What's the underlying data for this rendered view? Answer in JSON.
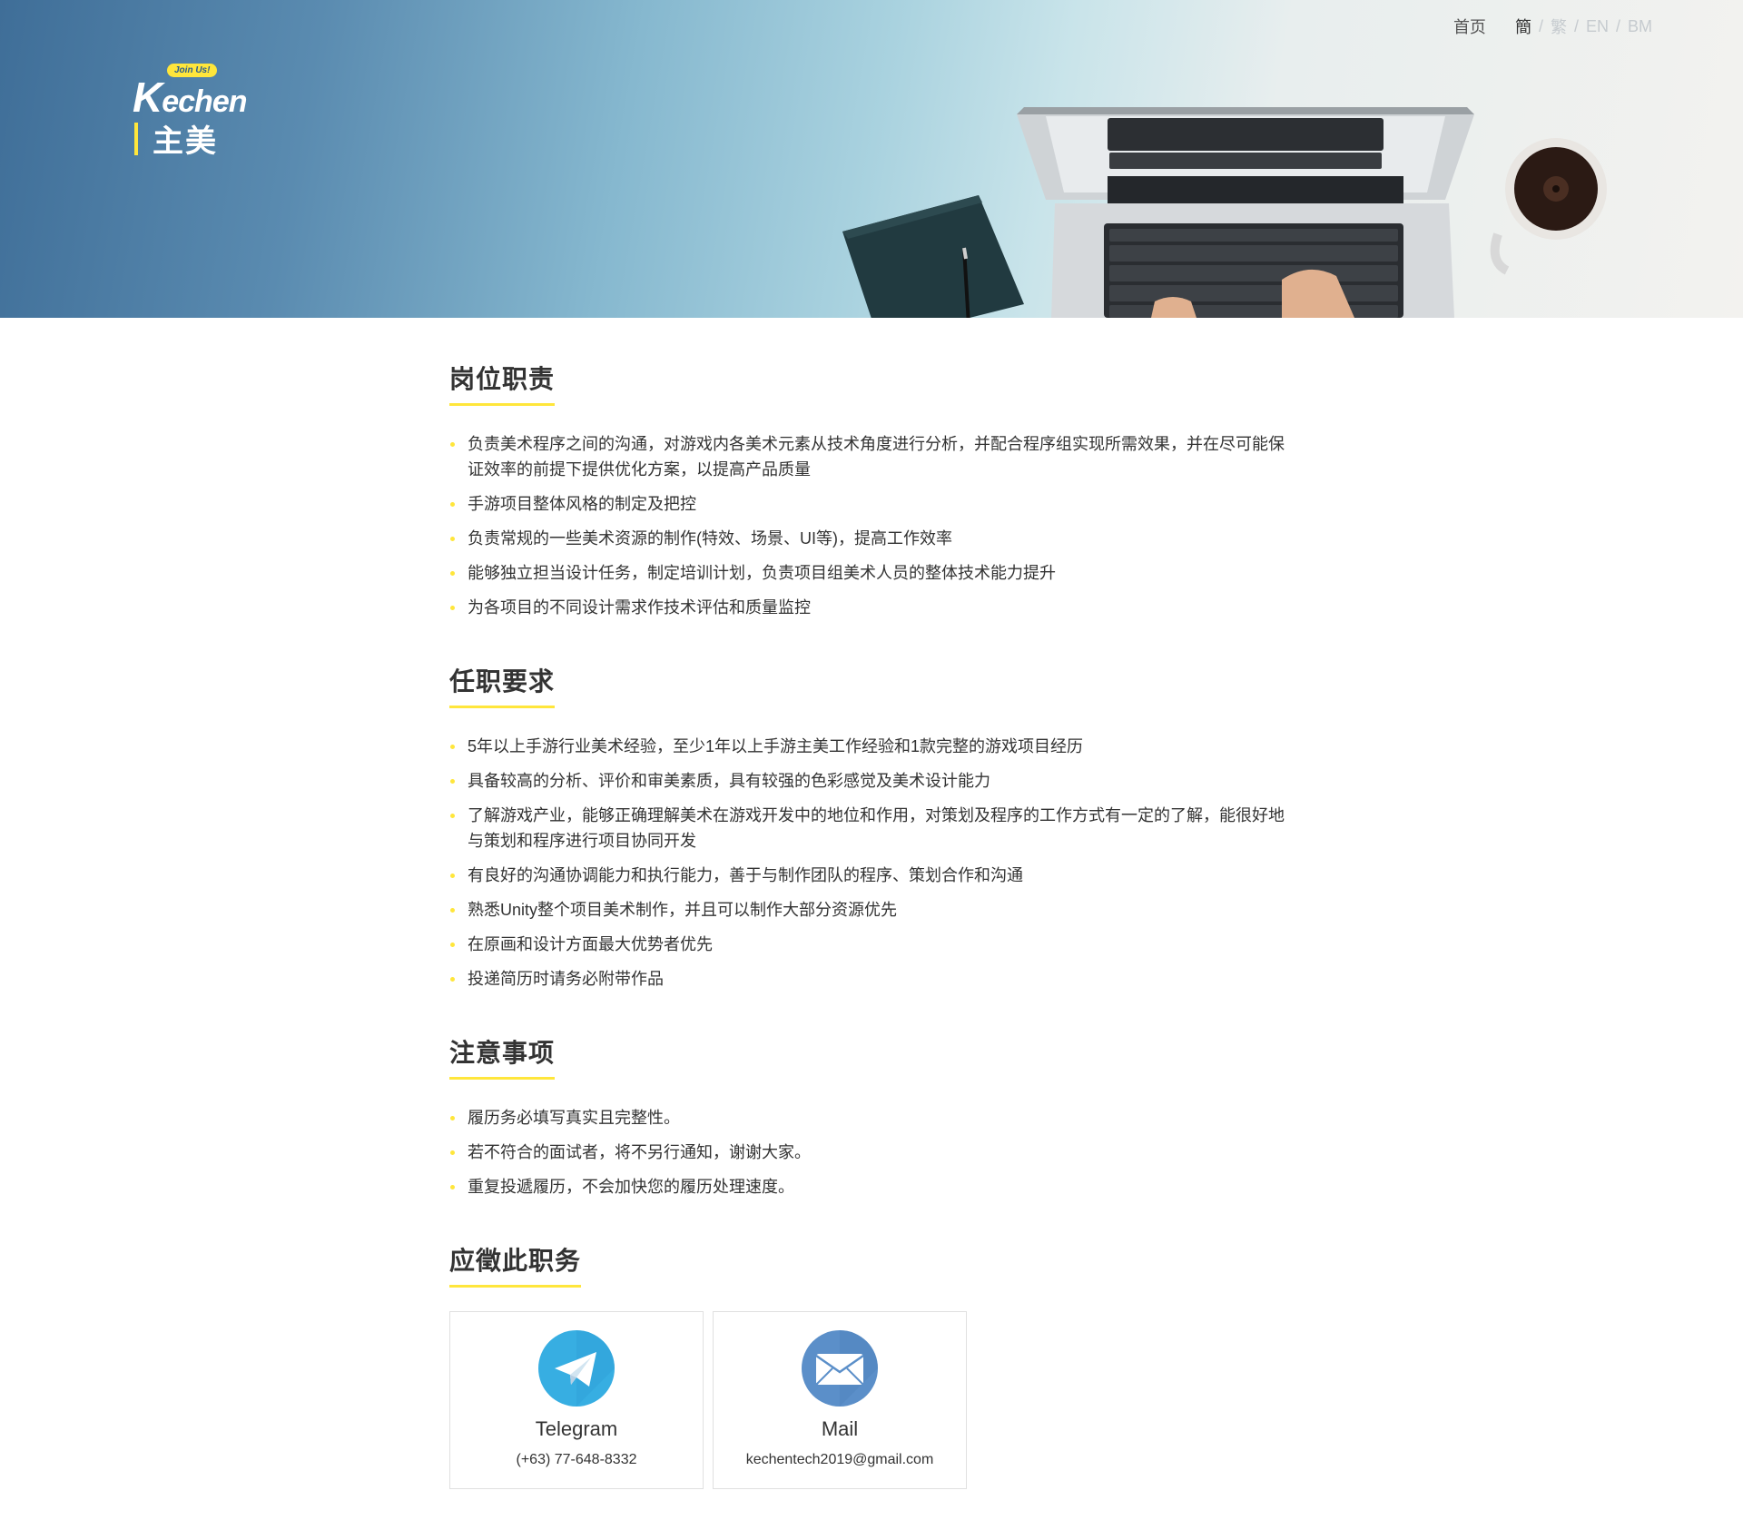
{
  "header": {
    "logo_badge": "Join Us!",
    "logo_k": "K",
    "logo_rest": "echen",
    "title": "主美",
    "nav_home": "首页",
    "languages": [
      "簡",
      "繁",
      "EN",
      "BM"
    ],
    "separator": "/"
  },
  "sections": [
    {
      "title": "岗位职责",
      "items": [
        "负责美术程序之间的沟通，对游戏内各美术元素从技术角度进行分析，并配合程序组实现所需效果，并在尽可能保证效率的前提下提供优化方案，以提高产品质量",
        "手游项目整体风格的制定及把控",
        "负责常规的一些美术资源的制作(特效、场景、UI等)，提高工作效率",
        "能够独立担当设计任务，制定培训计划，负责项目组美术人员的整体技术能力提升",
        "为各项目的不同设计需求作技术评估和质量监控"
      ]
    },
    {
      "title": "任职要求",
      "items": [
        "5年以上手游行业美术经验，至少1年以上手游主美工作经验和1款完整的游戏项目经历",
        "具备较高的分析、评价和审美素质，具有较强的色彩感觉及美术设计能力",
        "了解游戏产业，能够正确理解美术在游戏开发中的地位和作用，对策划及程序的工作方式有一定的了解，能很好地与策划和程序进行项目协同开发",
        "有良好的沟通协调能力和执行能力，善于与制作团队的程序、策划合作和沟通",
        "熟悉Unity整个项目美术制作，并且可以制作大部分资源优先",
        "在原画和设计方面最大优势者优先",
        "投递简历时请务必附带作品"
      ]
    },
    {
      "title": "注意事项",
      "items": [
        "履历务必填写真实且完整性。",
        "若不符合的面试者，将不另行通知，谢谢大家。",
        "重复投遞履历，不会加快您的履历处理速度。"
      ]
    }
  ],
  "apply": {
    "title": "应徵此职务",
    "cards": [
      {
        "name": "Telegram",
        "value": "(+63) 77-648-8332",
        "icon": "telegram-icon",
        "color": "#37aee2"
      },
      {
        "name": "Mail",
        "value": "kechentech2019@gmail.com",
        "icon": "mail-icon",
        "color": "#5b8fc9"
      }
    ]
  },
  "colors": {
    "accent": "#ffe63b",
    "text": "#333333",
    "lang_inactive": "#c6cbcf"
  }
}
